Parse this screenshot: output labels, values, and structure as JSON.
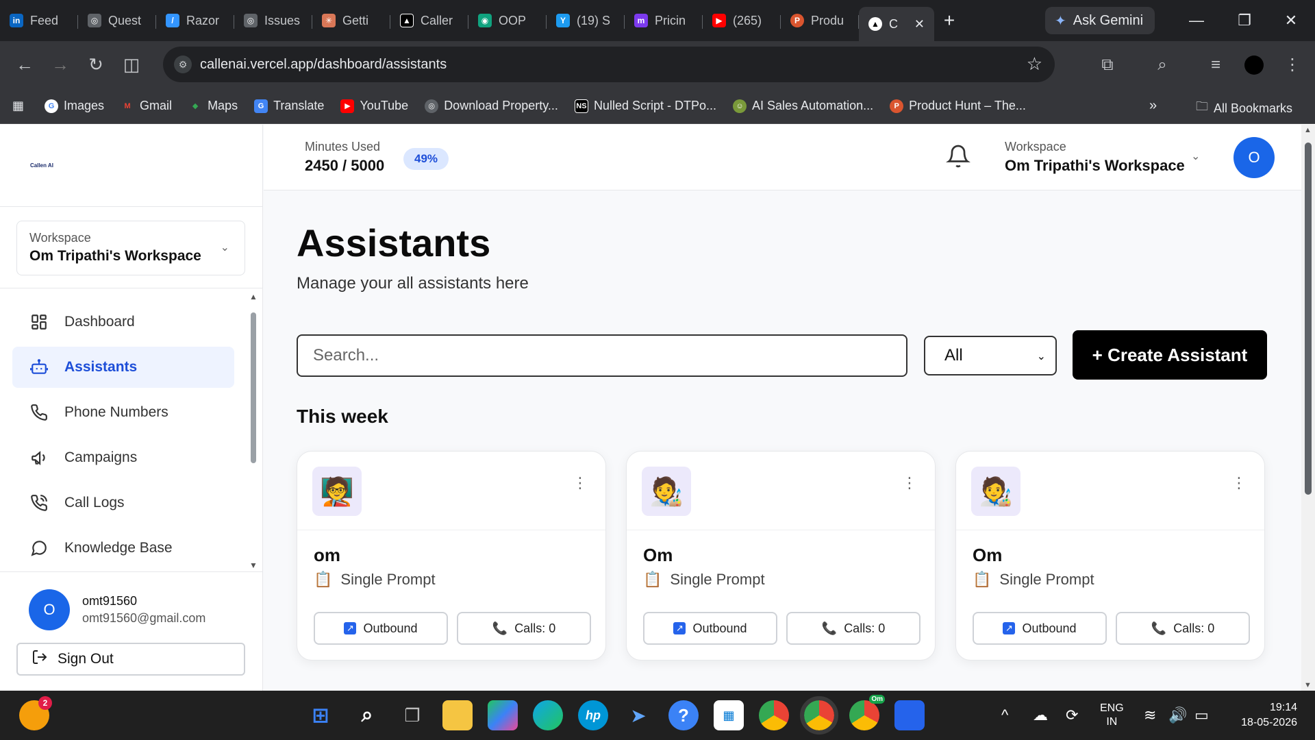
{
  "browser": {
    "tabs": [
      {
        "label": "Feed",
        "fav": "in",
        "color": "#0a66c2"
      },
      {
        "label": "Quest",
        "fav": "◎",
        "color": "#5f6368"
      },
      {
        "label": "Razor",
        "fav": "/",
        "color": "#3395ff"
      },
      {
        "label": "Issues",
        "fav": "◎",
        "color": "#5f6368"
      },
      {
        "label": "Getti",
        "fav": "✳",
        "color": "#d97757"
      },
      {
        "label": "Caller",
        "fav": "▲",
        "color": "#000000"
      },
      {
        "label": "OOP",
        "fav": "◉",
        "color": "#10a37f"
      },
      {
        "label": "(19) S",
        "fav": "Y",
        "color": "#1d9bf0"
      },
      {
        "label": "Pricin",
        "fav": "m",
        "color": "#7c3aed"
      },
      {
        "label": "(265)",
        "fav": "▶",
        "color": "#ff0000"
      },
      {
        "label": "Produ",
        "fav": "P",
        "color": "#da552f"
      }
    ],
    "active_tab": {
      "label": "C",
      "fav": "▲"
    },
    "ask_gemini": "Ask Gemini",
    "url": "callenai.vercel.app/dashboard/assistants",
    "bookmarks": [
      {
        "label": "Images",
        "fav": "G",
        "color": "#4285f4"
      },
      {
        "label": "Gmail",
        "fav": "M",
        "color": "#ea4335"
      },
      {
        "label": "Maps",
        "fav": "◆",
        "color": "#34a853"
      },
      {
        "label": "Translate",
        "fav": "G",
        "color": "#4285f4"
      },
      {
        "label": "YouTube",
        "fav": "▶",
        "color": "#ff0000"
      },
      {
        "label": "Download Property...",
        "fav": "◎",
        "color": "#5f6368"
      },
      {
        "label": "Nulled Script - DTPo...",
        "fav": "NS",
        "color": "#000000"
      },
      {
        "label": "AI Sales Automation...",
        "fav": "☺",
        "color": "#7a9a3a"
      },
      {
        "label": "Product Hunt – The...",
        "fav": "P",
        "color": "#da552f"
      }
    ],
    "all_bookmarks": "All Bookmarks"
  },
  "app": {
    "logo_text": "Callen AI",
    "sidebar": {
      "workspace_label": "Workspace",
      "workspace_name": "Om Tripathi's Workspace",
      "nav": [
        {
          "label": "Dashboard",
          "icon": "dashboard-icon"
        },
        {
          "label": "Assistants",
          "icon": "bot-icon",
          "active": true
        },
        {
          "label": "Phone Numbers",
          "icon": "phone-icon"
        },
        {
          "label": "Campaigns",
          "icon": "megaphone-icon"
        },
        {
          "label": "Call Logs",
          "icon": "call-log-icon"
        },
        {
          "label": "Knowledge Base",
          "icon": "chat-bubble-icon"
        }
      ],
      "user": {
        "initial": "O",
        "name": "omt91560",
        "email": "omt91560@gmail.com"
      },
      "sign_out": "Sign Out"
    },
    "topbar": {
      "minutes_label": "Minutes Used",
      "minutes_value": "2450 / 5000",
      "minutes_percent": "49%",
      "workspace_label": "Workspace",
      "workspace_name": "Om Tripathi's Workspace",
      "avatar_initial": "O"
    },
    "page": {
      "title": "Assistants",
      "subtitle": "Manage your all assistants here",
      "search_placeholder": "Search...",
      "filter_value": "All",
      "create_button": "+ Create Assistant",
      "section_title": "This week"
    },
    "assistants": [
      {
        "name": "om",
        "emoji": "🧑‍🏫",
        "type": "Single Prompt",
        "direction": "Outbound",
        "calls": "Calls: 0"
      },
      {
        "name": "Om",
        "emoji": "🧑‍🎨",
        "type": "Single Prompt",
        "direction": "Outbound",
        "calls": "Calls: 0"
      },
      {
        "name": "Om",
        "emoji": "🧑‍🎨",
        "type": "Single Prompt",
        "direction": "Outbound",
        "calls": "Calls: 0"
      }
    ]
  },
  "taskbar": {
    "notification_count": "2",
    "lang_line1": "ENG",
    "lang_line2": "IN",
    "time": "19:14",
    "date": "18-05-2026",
    "chrome_profile_badge": "Om"
  }
}
